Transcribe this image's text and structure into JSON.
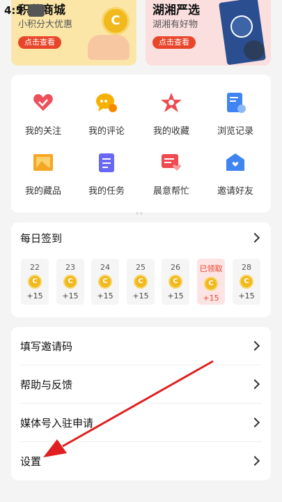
{
  "status": {
    "time": "4:5"
  },
  "promos": [
    {
      "title": "积分商城",
      "subtitle": "小积分大优惠",
      "button": "点击查看",
      "coin_letter": "C"
    },
    {
      "title": "湖湘严选",
      "subtitle": "湖湘有好物",
      "button": "点击查看"
    }
  ],
  "shortcuts": [
    {
      "label": "我的关注",
      "icon": "heart-icon",
      "color": "#ef4f5a"
    },
    {
      "label": "我的评论",
      "icon": "comment-icon",
      "color": "#f5b100"
    },
    {
      "label": "我的收藏",
      "icon": "star-icon",
      "color": "#ee4a50"
    },
    {
      "label": "浏览记录",
      "icon": "history-icon",
      "color": "#3f84f0"
    },
    {
      "label": "我的藏品",
      "icon": "collection-icon",
      "color": "#f5a623"
    },
    {
      "label": "我的任务",
      "icon": "task-icon",
      "color": "#6b67f5"
    },
    {
      "label": "晨意帮忙",
      "icon": "help-icon",
      "color": "#ee4a50"
    },
    {
      "label": "邀请好友",
      "icon": "invite-icon",
      "color": "#3f84f0"
    }
  ],
  "checkin": {
    "title": "每日签到",
    "coin_letter": "C",
    "days": [
      {
        "date": "22",
        "reward": "+15",
        "claimed": false
      },
      {
        "date": "23",
        "reward": "+15",
        "claimed": false
      },
      {
        "date": "24",
        "reward": "+15",
        "claimed": false
      },
      {
        "date": "25",
        "reward": "+15",
        "claimed": false
      },
      {
        "date": "26",
        "reward": "+15",
        "claimed": false
      },
      {
        "date": "已领取",
        "reward": "+15",
        "claimed": true
      },
      {
        "date": "28",
        "reward": "+15",
        "claimed": false
      }
    ]
  },
  "menu": [
    {
      "label": "填写邀请码"
    },
    {
      "label": "帮助与反馈"
    },
    {
      "label": "媒体号入驻申请"
    },
    {
      "label": "设置"
    }
  ],
  "colors": {
    "accent": "#e8452a",
    "arrow": "#e02020",
    "coin": "#f2b91e"
  }
}
